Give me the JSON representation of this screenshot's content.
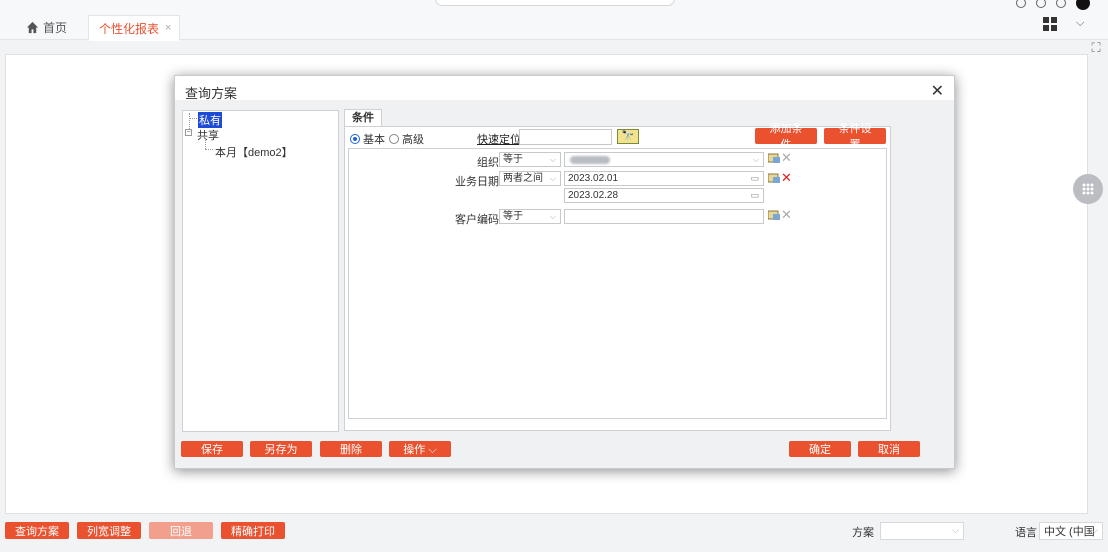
{
  "tabs": {
    "home_label": "首页",
    "active_label": "个性化报表",
    "close_glyph": "×"
  },
  "dialog": {
    "title": "查询方案",
    "close_glyph": "✕",
    "tree": {
      "private": "私有",
      "shared": "共享",
      "month_item": "本月【demo2】"
    },
    "condition_tab": "条件",
    "mode": {
      "basic": "基本",
      "advanced": "高级",
      "selected": "basic"
    },
    "quick_locate": "快速定位",
    "add_condition": "添加条件",
    "condition_settings": "条件设置",
    "fields": [
      {
        "label": "组织",
        "operator": "等于",
        "value": ""
      },
      {
        "label": "业务日期",
        "operator": "两者之间",
        "value": "2023.02.01",
        "value2": "2023.02.28"
      },
      {
        "label": "客户编码",
        "operator": "等于",
        "value": ""
      }
    ],
    "buttons": {
      "save": "保存",
      "save_as": "另存为",
      "delete": "删除",
      "operate": "操作 ⌵",
      "ok": "确定",
      "cancel": "取消"
    }
  },
  "bottom": {
    "query_plan": "查询方案",
    "col_width": "列宽调整",
    "back": "回退",
    "precise_print": "精确打印",
    "plan_label": "方案",
    "plan_value": "",
    "lang_label": "语言",
    "lang_value": "中文 (中国"
  },
  "colors": {
    "accent": "#e9512f",
    "selection": "#1e4bd6"
  }
}
